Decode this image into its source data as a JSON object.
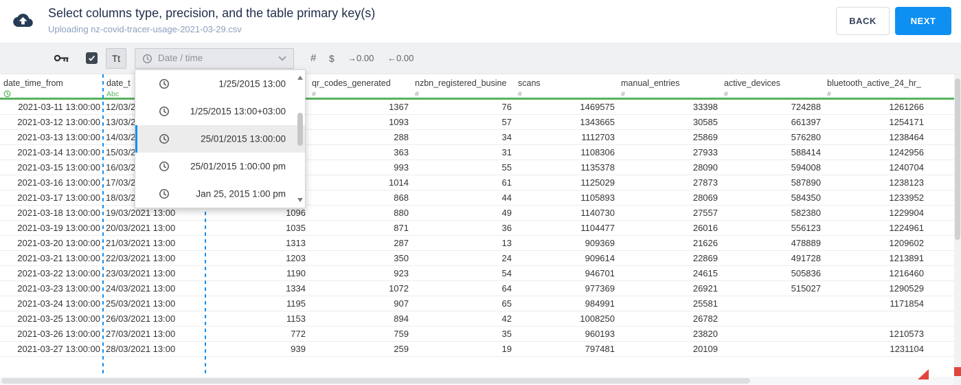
{
  "header": {
    "icon": "cloud-upload-icon",
    "title": "Select columns type, precision, and the table primary key(s)",
    "subtitle": "Uploading nz-covid-tracer-usage-2021-03-29.csv",
    "back_label": "BACK",
    "next_label": "NEXT"
  },
  "toolbar": {
    "icons": [
      "key-icon",
      "checkbox-checked-icon",
      "clock-icon",
      "chevron-down-icon"
    ],
    "text_type_label": "Tt",
    "type_value": "Date / time",
    "number_type_label": "#",
    "currency_type_label": "$",
    "increase_precision_label": "→0.00",
    "decrease_precision_label": "←0.00"
  },
  "format_dropdown": {
    "options": [
      {
        "label": "1/25/2015 13:00",
        "selected": false
      },
      {
        "label": "1/25/2015 13:00+03:00",
        "selected": false
      },
      {
        "label": "25/01/2015 13:00:00",
        "selected": true
      },
      {
        "label": "25/01/2015 1:00:00 pm",
        "selected": false
      },
      {
        "label": "Jan 25, 2015 1:00 pm",
        "selected": false
      }
    ]
  },
  "table": {
    "columns": [
      {
        "name": "date_time_from",
        "type": "date",
        "type_label": "",
        "align": "right"
      },
      {
        "name": "date_t",
        "type": "text",
        "type_label": "Abc",
        "align": "left"
      },
      {
        "name": "",
        "type": "unknown",
        "type_label": "",
        "align": "right"
      },
      {
        "name": "qr_codes_generated",
        "type": "number",
        "type_label": "#",
        "align": "right"
      },
      {
        "name": "nzbn_registered_busine",
        "type": "number",
        "type_label": "#",
        "align": "right"
      },
      {
        "name": "scans",
        "type": "number",
        "type_label": "#",
        "align": "right"
      },
      {
        "name": "manual_entries",
        "type": "number",
        "type_label": "#",
        "align": "right"
      },
      {
        "name": "active_devices",
        "type": "number",
        "type_label": "#",
        "align": "right"
      },
      {
        "name": "bluetooth_active_24_hr_",
        "type": "number",
        "type_label": "#",
        "align": "right"
      }
    ],
    "rows": [
      [
        "2021-03-11 13:00:00",
        "12/03/2",
        "",
        "1367",
        "76",
        "1469575",
        "33398",
        "724288",
        "1261266"
      ],
      [
        "2021-03-12 13:00:00",
        "13/03/2",
        "",
        "1093",
        "57",
        "1343665",
        "30585",
        "661397",
        "1254171"
      ],
      [
        "2021-03-13 13:00:00",
        "14/03/2",
        "",
        "288",
        "34",
        "1112703",
        "25869",
        "576280",
        "1238464"
      ],
      [
        "2021-03-14 13:00:00",
        "15/03/2",
        "",
        "363",
        "31",
        "1108306",
        "27933",
        "588414",
        "1242956"
      ],
      [
        "2021-03-15 13:00:00",
        "16/03/2",
        "",
        "993",
        "55",
        "1135378",
        "28090",
        "594008",
        "1240704"
      ],
      [
        "2021-03-16 13:00:00",
        "17/03/2",
        "",
        "1014",
        "61",
        "1125029",
        "27873",
        "587890",
        "1238123"
      ],
      [
        "2021-03-17 13:00:00",
        "18/03/2",
        "",
        "868",
        "44",
        "1105893",
        "28069",
        "584350",
        "1233952"
      ],
      [
        "2021-03-18 13:00:00",
        "19/03/2021 13:00",
        "1096",
        "880",
        "49",
        "1140730",
        "27557",
        "582380",
        "1229904"
      ],
      [
        "2021-03-19 13:00:00",
        "20/03/2021 13:00",
        "1035",
        "871",
        "36",
        "1104477",
        "26016",
        "556123",
        "1224961"
      ],
      [
        "2021-03-20 13:00:00",
        "21/03/2021 13:00",
        "1313",
        "287",
        "13",
        "909369",
        "21626",
        "478889",
        "1209602"
      ],
      [
        "2021-03-21 13:00:00",
        "22/03/2021 13:00",
        "1203",
        "350",
        "24",
        "909614",
        "22869",
        "491728",
        "1213891"
      ],
      [
        "2021-03-22 13:00:00",
        "23/03/2021 13:00",
        "1190",
        "923",
        "54",
        "946701",
        "24615",
        "505836",
        "1216460"
      ],
      [
        "2021-03-23 13:00:00",
        "24/03/2021 13:00",
        "1334",
        "1072",
        "64",
        "977369",
        "26921",
        "515027",
        "1290529"
      ],
      [
        "2021-03-24 13:00:00",
        "25/03/2021 13:00",
        "1195",
        "907",
        "65",
        "984991",
        "25581",
        "",
        "1171854"
      ],
      [
        "2021-03-25 13:00:00",
        "26/03/2021 13:00",
        "1153",
        "894",
        "42",
        "1008250",
        "26782",
        "",
        ""
      ],
      [
        "2021-03-26 13:00:00",
        "27/03/2021 13:00",
        "772",
        "759",
        "35",
        "960193",
        "23820",
        "",
        "1210573"
      ],
      [
        "2021-03-27 13:00:00",
        "28/03/2021 13:00",
        "939",
        "259",
        "19",
        "797481",
        "20109",
        "",
        "1231104"
      ]
    ]
  },
  "colors": {
    "accent": "#0e8ff2",
    "green": "#57b25c",
    "red": "#e2453c",
    "navy_icon": "#263c55"
  }
}
